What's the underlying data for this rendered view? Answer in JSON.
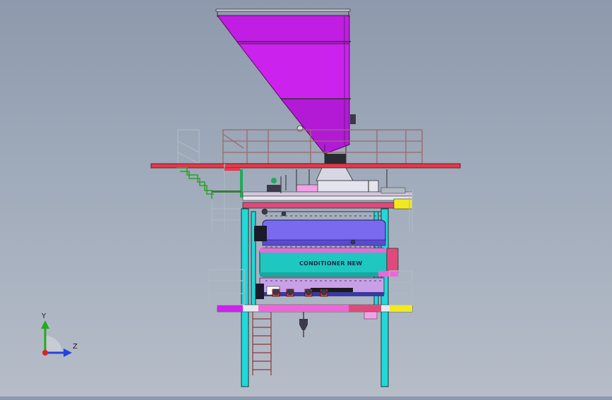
{
  "equipment": {
    "conditioner_label": "CONDITIONER NEW"
  },
  "triad": {
    "y_label": "Y",
    "z_label": "Z"
  },
  "colors": {
    "background_top": "#8e99ad",
    "background_bottom": "#b6bdc8",
    "hopper": "#cc22ee",
    "columns": "#22d8d8",
    "platform_beam": "#e23a4a",
    "conditioner_upper": "#7a6af0",
    "conditioner_main": "#1ec8c0",
    "conditioner_lower": "#ee66d8",
    "floor_yellow": "#f2ea1e",
    "railing": "#b8bcc4",
    "ladder": "#8a3a3a",
    "axis_y": "#22aa22",
    "axis_z": "#2244dd",
    "axis_origin": "#dd2222"
  },
  "icons": [
    "coordinate-triad-icon"
  ]
}
